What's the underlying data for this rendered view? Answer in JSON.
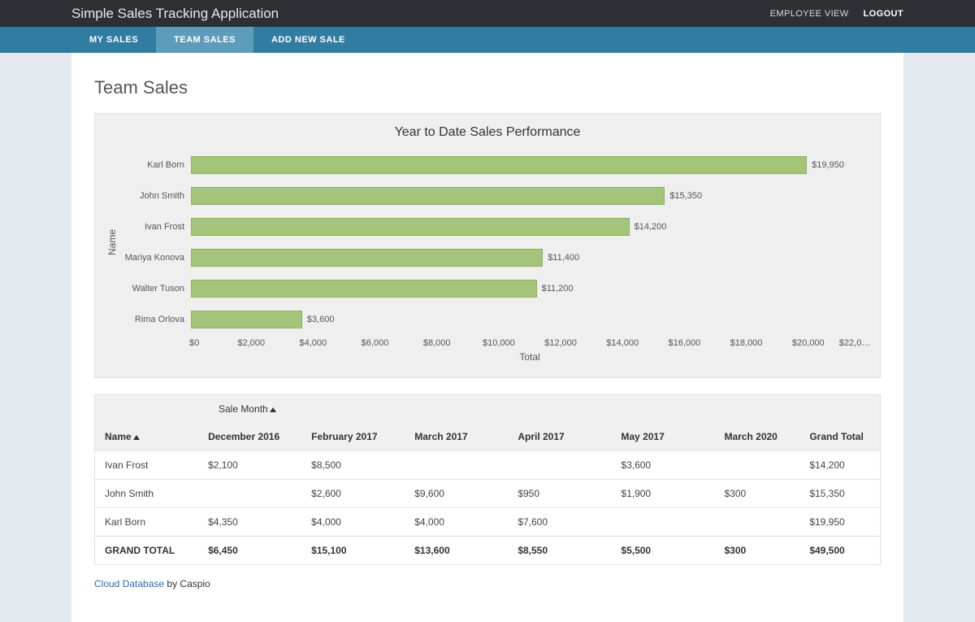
{
  "header": {
    "app_title": "Simple Sales Tracking Application",
    "employee_view": "EMPLOYEE VIEW",
    "logout": "LOGOUT"
  },
  "nav": {
    "my_sales": "MY SALES",
    "team_sales": "TEAM SALES",
    "add_new_sale": "ADD NEW SALE"
  },
  "page": {
    "title": "Team Sales"
  },
  "chart_data": {
    "type": "bar",
    "orientation": "horizontal",
    "title": "Year to Date Sales Performance",
    "ylabel": "Name",
    "xlabel": "Total",
    "xlim": [
      0,
      22000
    ],
    "x_ticks": [
      "$0",
      "$2,000",
      "$4,000",
      "$6,000",
      "$8,000",
      "$10,000",
      "$12,000",
      "$14,000",
      "$16,000",
      "$18,000",
      "$20,000",
      "$22,0…"
    ],
    "categories": [
      "Karl Born",
      "John Smith",
      "Ivan Frost",
      "Mariya Konova",
      "Walter Tuson",
      "Rima Orlova"
    ],
    "values": [
      19950,
      15350,
      14200,
      11400,
      11200,
      3600
    ],
    "value_labels": [
      "$19,950",
      "$15,350",
      "$14,200",
      "$11,400",
      "$11,200",
      "$3,600"
    ]
  },
  "table": {
    "super_header": "Sale Month",
    "columns": [
      "Name",
      "December 2016",
      "February 2017",
      "March 2017",
      "April 2017",
      "May 2017",
      "March 2020",
      "Grand Total"
    ],
    "rows": [
      {
        "name": "Ivan Frost",
        "cells": [
          "$2,100",
          "$8,500",
          "",
          "",
          "$3,600",
          "",
          "$14,200"
        ]
      },
      {
        "name": "John Smith",
        "cells": [
          "",
          "$2,600",
          "$9,600",
          "$950",
          "$1,900",
          "$300",
          "$15,350"
        ]
      },
      {
        "name": "Karl Born",
        "cells": [
          "$4,350",
          "$4,000",
          "$4,000",
          "$7,600",
          "",
          "",
          "$19,950"
        ]
      }
    ],
    "grand_total_label": "GRAND TOTAL",
    "grand_total": [
      "$6,450",
      "$15,100",
      "$13,600",
      "$8,550",
      "$5,500",
      "$300",
      "$49,500"
    ]
  },
  "footer": {
    "link_text": "Cloud Database",
    "by_text": " by Caspio"
  }
}
